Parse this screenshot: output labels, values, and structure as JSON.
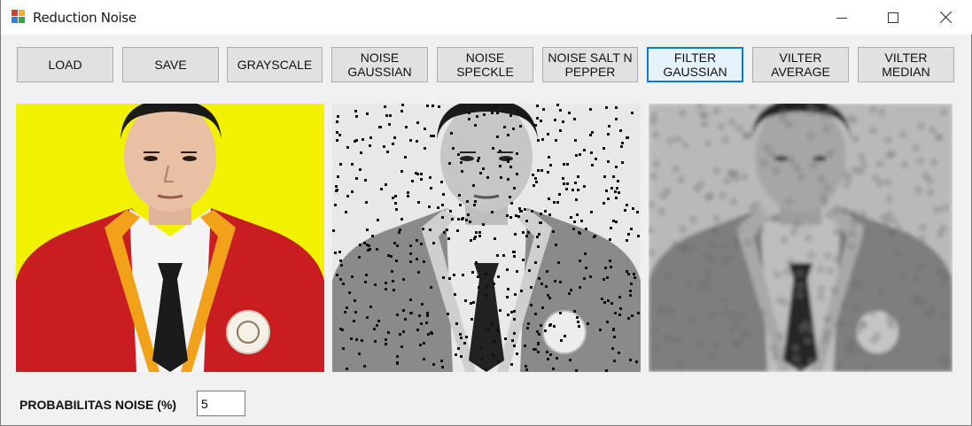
{
  "window": {
    "title": "Reduction Noise",
    "icon": "windows-forms-app-icon",
    "controls": [
      "minimize-icon",
      "maximize-icon",
      "close-icon"
    ]
  },
  "toolbar": {
    "buttons": [
      {
        "id": "load",
        "label": "LOAD"
      },
      {
        "id": "save",
        "label": "SAVE"
      },
      {
        "id": "grayscale",
        "label": "GRAYSCALE"
      },
      {
        "id": "noise-gaussian",
        "label": "NOISE\nGAUSSIAN"
      },
      {
        "id": "noise-speckle",
        "label": "NOISE\nSPECKLE"
      },
      {
        "id": "noise-salt-pepper",
        "label": "NOISE SALT N\nPEPPER"
      },
      {
        "id": "filter-gaussian",
        "label": "FILTER\nGAUSSIAN",
        "focused": true
      },
      {
        "id": "vilter-average",
        "label": "VILTER\nAVERAGE"
      },
      {
        "id": "vilter-median",
        "label": "VILTER\nMEDIAN"
      }
    ]
  },
  "images": [
    {
      "id": "original",
      "description": "color portrait photo"
    },
    {
      "id": "noisy",
      "description": "grayscale portrait with salt-and-pepper noise"
    },
    {
      "id": "filtered",
      "description": "gaussian-filtered grayscale portrait"
    }
  ],
  "noise_control": {
    "label": "PROBABILITAS NOISE (%)",
    "value": "5"
  },
  "colors": {
    "title_bar": "#ffffff",
    "form_background": "#f0f0f0",
    "button_face": "#e1e1e1",
    "focus_border": "#0a78d7",
    "photo_background": "#f2f200",
    "jacket_red": "#c81e22",
    "jacket_trim": "#f2a21a"
  }
}
